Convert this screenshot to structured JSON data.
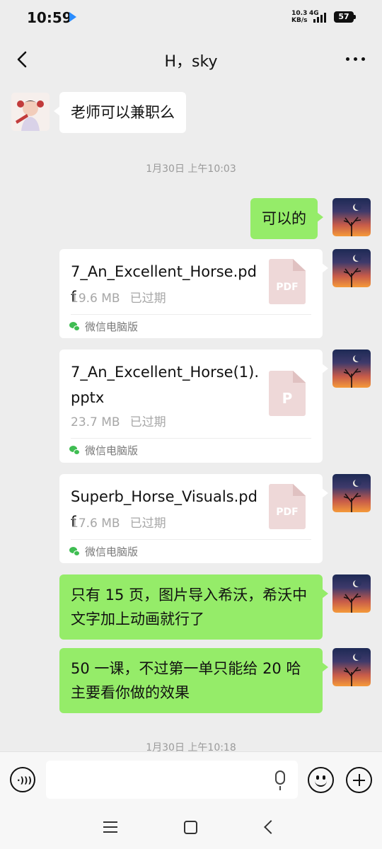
{
  "status_bar": {
    "time": "10:59",
    "net_speed_value": "10.3",
    "net_speed_unit": "KB/s",
    "network_type": "4G",
    "battery": "57"
  },
  "header": {
    "title": "H，sky"
  },
  "messages": {
    "m1_text": "老师可以兼职么",
    "ts1": "1月30日 上午10:03",
    "m2_text": "可以的",
    "file1": {
      "name": "7_An_Excellent_Horse.pdf",
      "size": "19.6 MB",
      "status": "已过期",
      "source": "微信电脑版",
      "icon_label": "PDF"
    },
    "file2": {
      "name": "7_An_Excellent_Horse(1).pptx",
      "size": "23.7 MB",
      "status": "已过期",
      "source": "微信电脑版",
      "icon_label": "P"
    },
    "file3": {
      "name": "Superb_Horse_Visuals.pdf",
      "size": "17.6 MB",
      "status": "已过期",
      "source": "微信电脑版",
      "icon_label": "PDF"
    },
    "m6_text": "只有 15 页，图片导入希沃，希沃中文字加上动画就行了",
    "m7_text": "50 一课，不过第一单只能给 20 哈主要看你做的效果",
    "ts2": "1月30日 上午10:18"
  },
  "input_bar": {
    "placeholder": ""
  },
  "icons": {
    "back": "back-chevron-icon",
    "more": "more-dots-icon",
    "voice": "voice-icon",
    "mic": "mic-icon",
    "emoji": "emoji-icon",
    "plus": "plus-icon",
    "wechat": "wechat-icon",
    "file_pdf": "pdf-file-icon",
    "file_ppt": "ppt-file-icon"
  },
  "colors": {
    "background": "#ededed",
    "sent_bubble": "#95ec69",
    "received_bubble": "#ffffff",
    "timestamp": "#9a9a9a"
  }
}
